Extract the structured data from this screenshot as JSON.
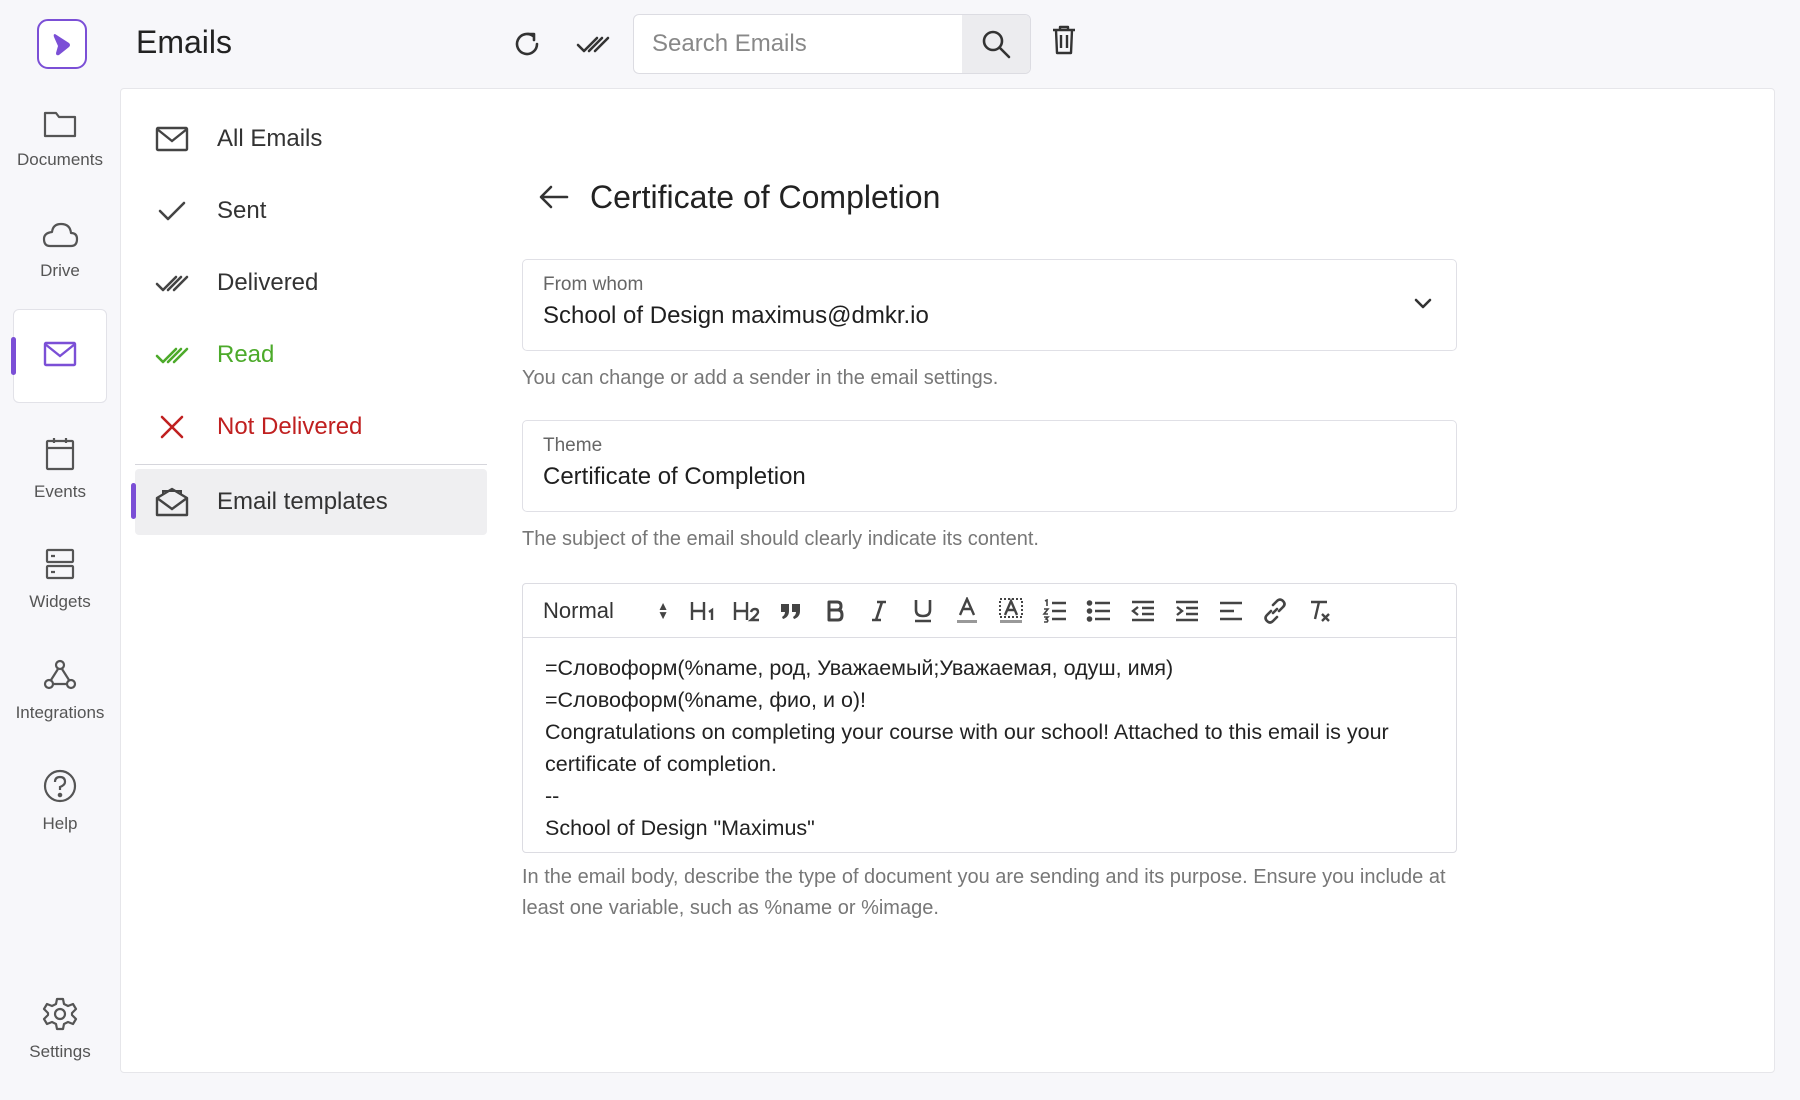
{
  "app": {
    "title": "Emails"
  },
  "rail": {
    "items": [
      {
        "label": "Documents",
        "icon": "folder-icon"
      },
      {
        "label": "Drive",
        "icon": "cloud-icon"
      },
      {
        "label": "",
        "icon": "mail-icon",
        "active": true
      },
      {
        "label": "Events",
        "icon": "calendar-icon"
      },
      {
        "label": "Widgets",
        "icon": "widgets-icon"
      },
      {
        "label": "Integrations",
        "icon": "webhook-icon"
      },
      {
        "label": "Help",
        "icon": "help-icon"
      }
    ],
    "settings_label": "Settings"
  },
  "header": {
    "search_placeholder": "Search Emails"
  },
  "folders": [
    {
      "label": "All Emails",
      "icon": "envelope-icon"
    },
    {
      "label": "Sent",
      "icon": "check-icon"
    },
    {
      "label": "Delivered",
      "icon": "double-check-icon"
    },
    {
      "label": "Read",
      "icon": "double-check-green-icon",
      "color": "#4caa2a"
    },
    {
      "label": "Not Delivered",
      "icon": "x-icon",
      "color": "#c02020"
    },
    {
      "label": "Email templates",
      "icon": "open-envelope-icon",
      "selected": true
    }
  ],
  "editor": {
    "title": "Certificate of Completion",
    "from": {
      "label": "From whom",
      "value": "School of Design maximus@dmkr.io",
      "hint": "You can change or add a sender in the email settings."
    },
    "theme": {
      "label": "Theme",
      "value": "Certificate of Completion",
      "hint": "The subject of the email should clearly indicate its content."
    },
    "toolbar": {
      "format": "Normal"
    },
    "body_lines": [
      "=Словоформ(%name, род, Уважаемый;Уважаемая, одуш, имя)",
      "=Словоформ(%name, фио, и о)!",
      "Congratulations on completing your course with our school! Attached to this email is your certificate of completion.",
      "--",
      "School of Design \"Maximus\""
    ],
    "body_hint": "In the email body, describe the type of document you are sending and its purpose. Ensure you include at least one variable, such as %name or %image."
  },
  "colors": {
    "accent": "#7b4fd6",
    "read": "#4caa2a",
    "error": "#c02020"
  }
}
